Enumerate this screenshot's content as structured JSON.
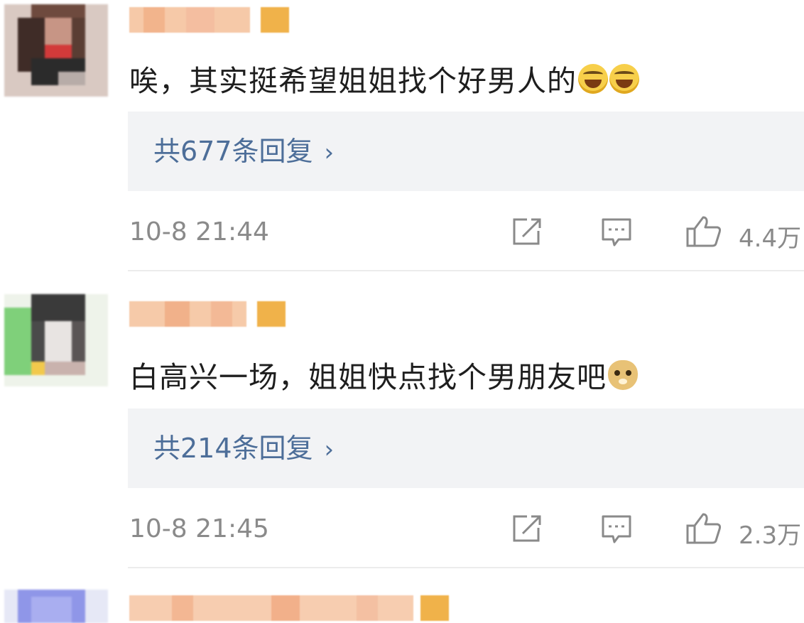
{
  "comments": [
    {
      "text": "唉，其实挺希望姐姐找个好男人的",
      "emoji": [
        "laughing-crying-emoji",
        "laughing-crying-emoji"
      ],
      "replies_label": "共677条回复",
      "time": "10-8 21:44",
      "likes": "4.4万"
    },
    {
      "text": "白高兴一场，姐姐快点找个男朋友吧",
      "emoji": [
        "doge-emoji"
      ],
      "replies_label": "共214条回复",
      "time": "10-8 21:45",
      "likes": "2.3万"
    }
  ],
  "icons": {
    "share": "share-icon",
    "comment": "comment-icon",
    "like": "thumbs-up-icon",
    "chevron": "chevron-right-icon"
  },
  "colors": {
    "reply_link": "#4d6e99",
    "reply_bg": "#f2f3f5",
    "meta": "#8a8a8a"
  }
}
